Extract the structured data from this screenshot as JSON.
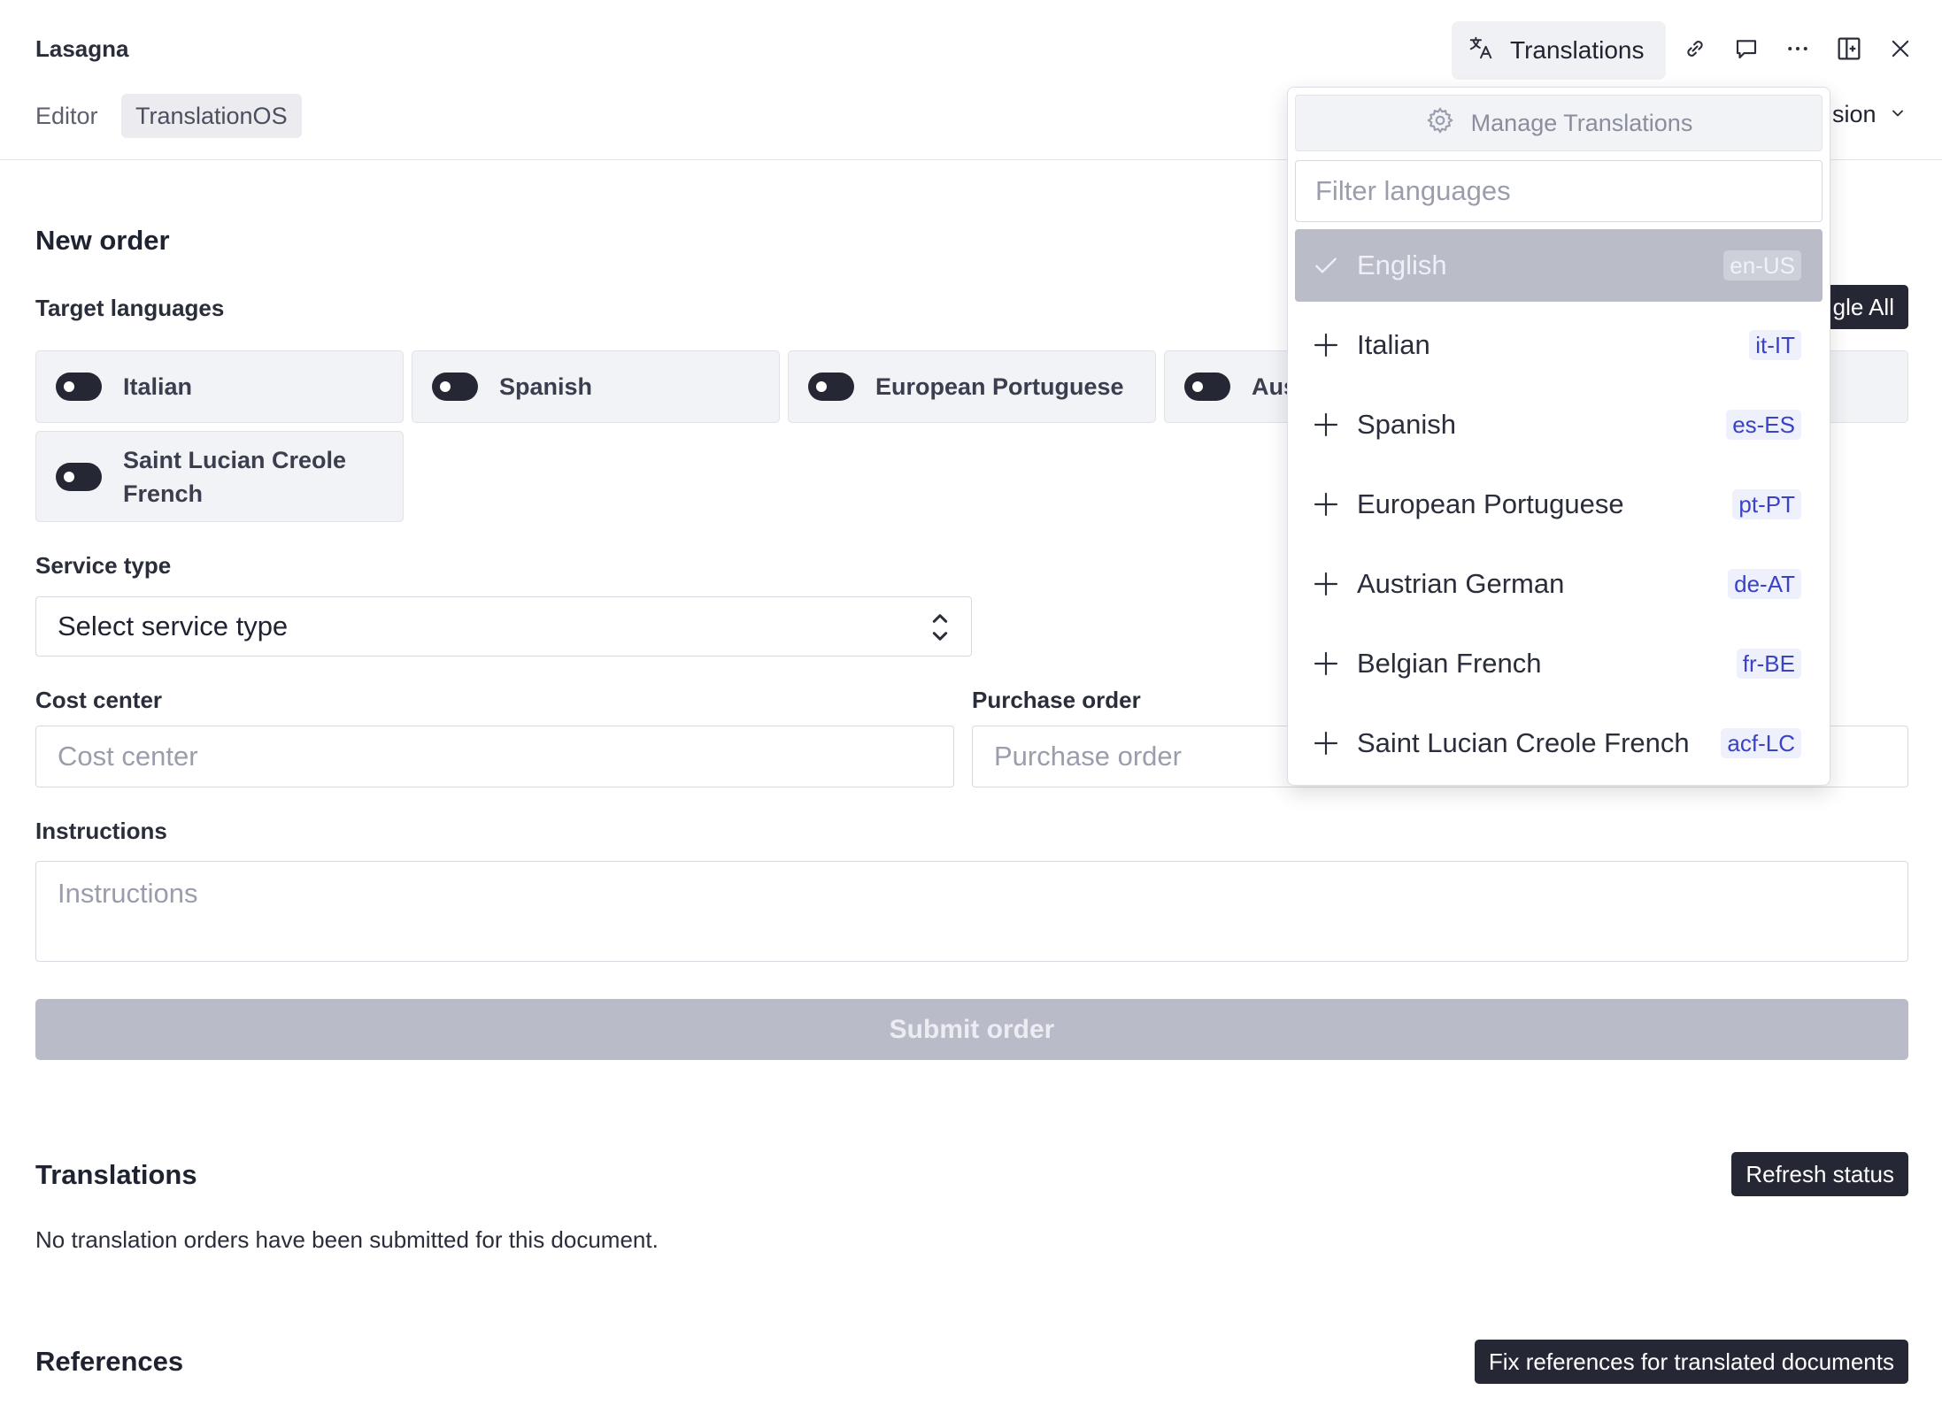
{
  "header": {
    "title": "Lasagna",
    "tabs": [
      {
        "label": "Editor"
      },
      {
        "label": "TranslationOS"
      }
    ],
    "translations_button": "Translations",
    "version_label": "sion",
    "icons": [
      "translate-icon",
      "link-icon",
      "comment-icon",
      "more-icon",
      "split-pane-icon",
      "close-icon"
    ]
  },
  "new_order": {
    "heading": "New order",
    "target_languages_label": "Target languages",
    "toggle_all_label": "gle All",
    "languages": [
      {
        "name": "Italian"
      },
      {
        "name": "Spanish"
      },
      {
        "name": "European Portuguese"
      },
      {
        "name": "Aus"
      },
      {
        "name": "Saint Lucian Creole French"
      }
    ],
    "service_type_label": "Service type",
    "service_type_value": "Select service type",
    "cost_center_label": "Cost center",
    "cost_center_placeholder": "Cost center",
    "purchase_order_label": "Purchase order",
    "purchase_order_placeholder": "Purchase order",
    "instructions_label": "Instructions",
    "instructions_placeholder": "Instructions",
    "submit_label": "Submit order"
  },
  "translations": {
    "heading": "Translations",
    "refresh_label": "Refresh status",
    "empty_text": "No translation orders have been submitted for this document."
  },
  "references": {
    "heading": "References",
    "fix_label": "Fix references for translated documents"
  },
  "dropdown": {
    "manage_label": "Manage Translations",
    "filter_placeholder": "Filter languages",
    "items": [
      {
        "name": "English",
        "code": "en-US",
        "selected": true
      },
      {
        "name": "Italian",
        "code": "it-IT",
        "selected": false
      },
      {
        "name": "Spanish",
        "code": "es-ES",
        "selected": false
      },
      {
        "name": "European Portuguese",
        "code": "pt-PT",
        "selected": false
      },
      {
        "name": "Austrian German",
        "code": "de-AT",
        "selected": false
      },
      {
        "name": "Belgian French",
        "code": "fr-BE",
        "selected": false
      },
      {
        "name": "Saint Lucian Creole French",
        "code": "acf-LC",
        "selected": false
      }
    ]
  },
  "colors": {
    "dark": "#252734",
    "selected_bg": "#babcc8",
    "code_text": "#3a42c8"
  }
}
